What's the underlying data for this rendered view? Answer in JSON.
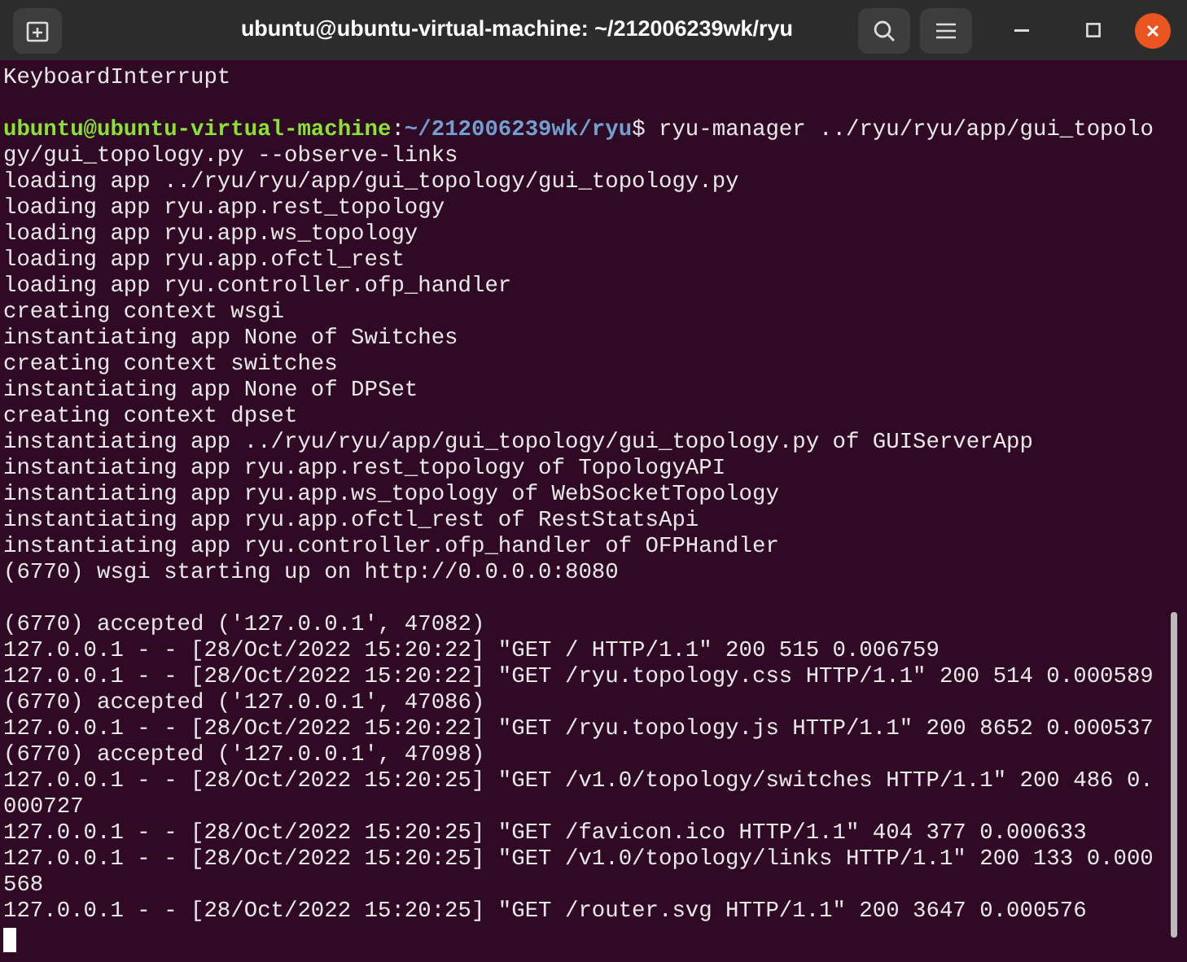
{
  "window": {
    "title": "ubuntu@ubuntu-virtual-machine: ~/212006239wk/ryu"
  },
  "terminal": {
    "lines": [
      {
        "kind": "output",
        "text": "KeyboardInterrupt"
      },
      {
        "kind": "blank"
      },
      {
        "kind": "prompt",
        "user_host": "ubuntu@ubuntu-virtual-machine",
        "separator": ":",
        "path": "~/212006239wk/ryu",
        "symbol": "$",
        "command": " ryu-manager ../ryu/ryu/app/gui_topolo"
      },
      {
        "kind": "output",
        "text": "gy/gui_topology.py --observe-links"
      },
      {
        "kind": "output",
        "text": "loading app ../ryu/ryu/app/gui_topology/gui_topology.py"
      },
      {
        "kind": "output",
        "text": "loading app ryu.app.rest_topology"
      },
      {
        "kind": "output",
        "text": "loading app ryu.app.ws_topology"
      },
      {
        "kind": "output",
        "text": "loading app ryu.app.ofctl_rest"
      },
      {
        "kind": "output",
        "text": "loading app ryu.controller.ofp_handler"
      },
      {
        "kind": "output",
        "text": "creating context wsgi"
      },
      {
        "kind": "output",
        "text": "instantiating app None of Switches"
      },
      {
        "kind": "output",
        "text": "creating context switches"
      },
      {
        "kind": "output",
        "text": "instantiating app None of DPSet"
      },
      {
        "kind": "output",
        "text": "creating context dpset"
      },
      {
        "kind": "output",
        "text": "instantiating app ../ryu/ryu/app/gui_topology/gui_topology.py of GUIServerApp"
      },
      {
        "kind": "output",
        "text": "instantiating app ryu.app.rest_topology of TopologyAPI"
      },
      {
        "kind": "output",
        "text": "instantiating app ryu.app.ws_topology of WebSocketTopology"
      },
      {
        "kind": "output",
        "text": "instantiating app ryu.app.ofctl_rest of RestStatsApi"
      },
      {
        "kind": "output",
        "text": "instantiating app ryu.controller.ofp_handler of OFPHandler"
      },
      {
        "kind": "output",
        "text": "(6770) wsgi starting up on http://0.0.0.0:8080"
      },
      {
        "kind": "blank"
      },
      {
        "kind": "output",
        "text": "(6770) accepted ('127.0.0.1', 47082)"
      },
      {
        "kind": "output",
        "text": "127.0.0.1 - - [28/Oct/2022 15:20:22] \"GET / HTTP/1.1\" 200 515 0.006759"
      },
      {
        "kind": "output",
        "text": "127.0.0.1 - - [28/Oct/2022 15:20:22] \"GET /ryu.topology.css HTTP/1.1\" 200 514 0.000589"
      },
      {
        "kind": "output",
        "text": "(6770) accepted ('127.0.0.1', 47086)"
      },
      {
        "kind": "output",
        "text": "127.0.0.1 - - [28/Oct/2022 15:20:22] \"GET /ryu.topology.js HTTP/1.1\" 200 8652 0.000537"
      },
      {
        "kind": "output",
        "text": "(6770) accepted ('127.0.0.1', 47098)"
      },
      {
        "kind": "output",
        "text": "127.0.0.1 - - [28/Oct/2022 15:20:25] \"GET /v1.0/topology/switches HTTP/1.1\" 200 486 0."
      },
      {
        "kind": "output",
        "text": "000727"
      },
      {
        "kind": "output",
        "text": "127.0.0.1 - - [28/Oct/2022 15:20:25] \"GET /favicon.ico HTTP/1.1\" 404 377 0.000633"
      },
      {
        "kind": "output",
        "text": "127.0.0.1 - - [28/Oct/2022 15:20:25] \"GET /v1.0/topology/links HTTP/1.1\" 200 133 0.000"
      },
      {
        "kind": "output",
        "text": "568"
      },
      {
        "kind": "output",
        "text": "127.0.0.1 - - [28/Oct/2022 15:20:25] \"GET /router.svg HTTP/1.1\" 200 3647 0.000576"
      },
      {
        "kind": "cursor"
      }
    ]
  }
}
